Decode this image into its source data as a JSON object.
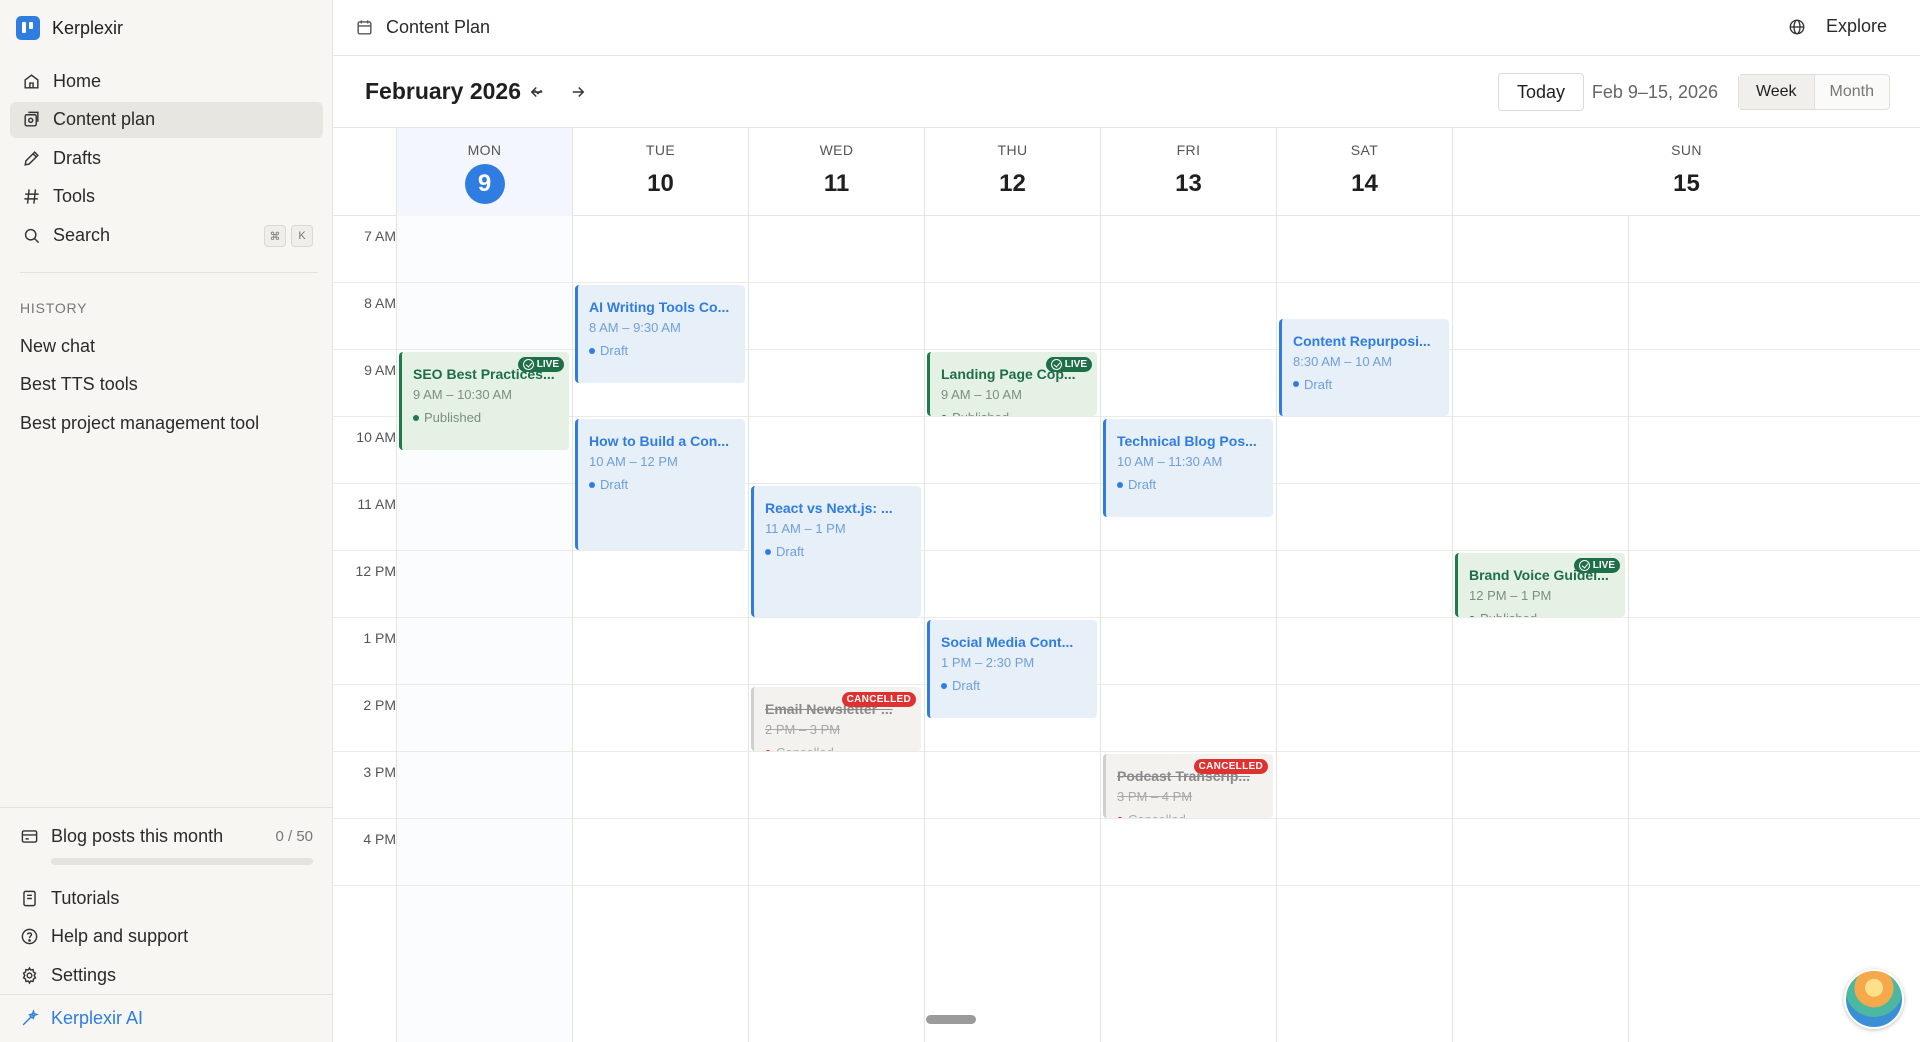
{
  "app": {
    "name": "Kerplexir",
    "ai_label": "Kerplexir AI"
  },
  "sidebar": {
    "nav": [
      {
        "label": "Home",
        "icon": "home-icon"
      },
      {
        "label": "Content plan",
        "icon": "content-plan-icon",
        "active": true
      },
      {
        "label": "Drafts",
        "icon": "pen-icon"
      },
      {
        "label": "Tools",
        "icon": "hash-icon"
      },
      {
        "label": "Search",
        "icon": "search-icon",
        "shortcut": [
          "⌘",
          "K"
        ]
      }
    ],
    "history_title": "HISTORY",
    "history": [
      "New chat",
      "Best TTS tools",
      "Best project management tool"
    ],
    "usage": {
      "label": "Blog posts this month",
      "count": "0 / 50",
      "progress": 0
    },
    "bottom_nav": [
      {
        "label": "Tutorials",
        "icon": "book-icon"
      },
      {
        "label": "Help and support",
        "icon": "help-icon"
      },
      {
        "label": "Settings",
        "icon": "gear-icon"
      }
    ]
  },
  "topbar": {
    "title": "Content Plan",
    "explore": "Explore"
  },
  "toolbar": {
    "month": "February 2026",
    "today": "Today",
    "range": "Feb 9–15, 2026",
    "views": [
      "Week",
      "Month"
    ],
    "active_view": "Week"
  },
  "calendar": {
    "days": [
      {
        "name": "MON",
        "num": "9",
        "today": true
      },
      {
        "name": "TUE",
        "num": "10"
      },
      {
        "name": "WED",
        "num": "11"
      },
      {
        "name": "THU",
        "num": "12"
      },
      {
        "name": "FRI",
        "num": "13"
      },
      {
        "name": "SAT",
        "num": "14"
      },
      {
        "name": "SUN",
        "num": "15"
      }
    ],
    "hours": [
      "7 AM",
      "8 AM",
      "9 AM",
      "10 AM",
      "11 AM",
      "12 PM",
      "1 PM",
      "2 PM",
      "3 PM",
      "4 PM"
    ],
    "events": [
      {
        "day": 0,
        "start": 9,
        "end": 10.5,
        "title": "SEO Best Practices...",
        "time": "9 AM – 10:30 AM",
        "status": "Published",
        "kind": "published",
        "badge": "LIVE"
      },
      {
        "day": 1,
        "start": 8,
        "end": 9.5,
        "title": "AI Writing Tools Co...",
        "time": "8 AM – 9:30 AM",
        "status": "Draft",
        "kind": "draft"
      },
      {
        "day": 1,
        "start": 10,
        "end": 12,
        "title": "How to Build a Con...",
        "time": "10 AM – 12 PM",
        "status": "Draft",
        "kind": "draft"
      },
      {
        "day": 2,
        "start": 11,
        "end": 13,
        "title": "React vs Next.js: ...",
        "time": "11 AM – 1 PM",
        "status": "Draft",
        "kind": "draft"
      },
      {
        "day": 2,
        "start": 14,
        "end": 15,
        "title": "Email Newsletter ...",
        "time": "2 PM – 3 PM",
        "status": "Cancelled",
        "kind": "cancelled",
        "badge": "CANCELLED"
      },
      {
        "day": 3,
        "start": 9,
        "end": 10,
        "title": "Landing Page Cop...",
        "time": "9 AM – 10 AM",
        "status": "Published",
        "kind": "published",
        "badge": "LIVE"
      },
      {
        "day": 3,
        "start": 13,
        "end": 14.5,
        "title": "Social Media Cont...",
        "time": "1 PM – 2:30 PM",
        "status": "Draft",
        "kind": "draft"
      },
      {
        "day": 4,
        "start": 10,
        "end": 11.5,
        "title": "Technical Blog Pos...",
        "time": "10 AM – 11:30 AM",
        "status": "Draft",
        "kind": "draft"
      },
      {
        "day": 4,
        "start": 15,
        "end": 16,
        "title": "Podcast Transcrip...",
        "time": "3 PM – 4 PM",
        "status": "Cancelled",
        "kind": "cancelled",
        "badge": "CANCELLED"
      },
      {
        "day": 5,
        "start": 8.5,
        "end": 10,
        "title": "Content Repurposi...",
        "time": "8:30 AM – 10 AM",
        "status": "Draft",
        "kind": "draft"
      },
      {
        "day": 6,
        "start": 12,
        "end": 13,
        "title": "Brand Voice Guidel...",
        "time": "12 PM – 1 PM",
        "status": "Published",
        "kind": "published",
        "badge": "LIVE"
      }
    ]
  },
  "colors": {
    "accent": "#2f7de1",
    "published": "#1e6e48",
    "cancelled": "#e03131"
  }
}
